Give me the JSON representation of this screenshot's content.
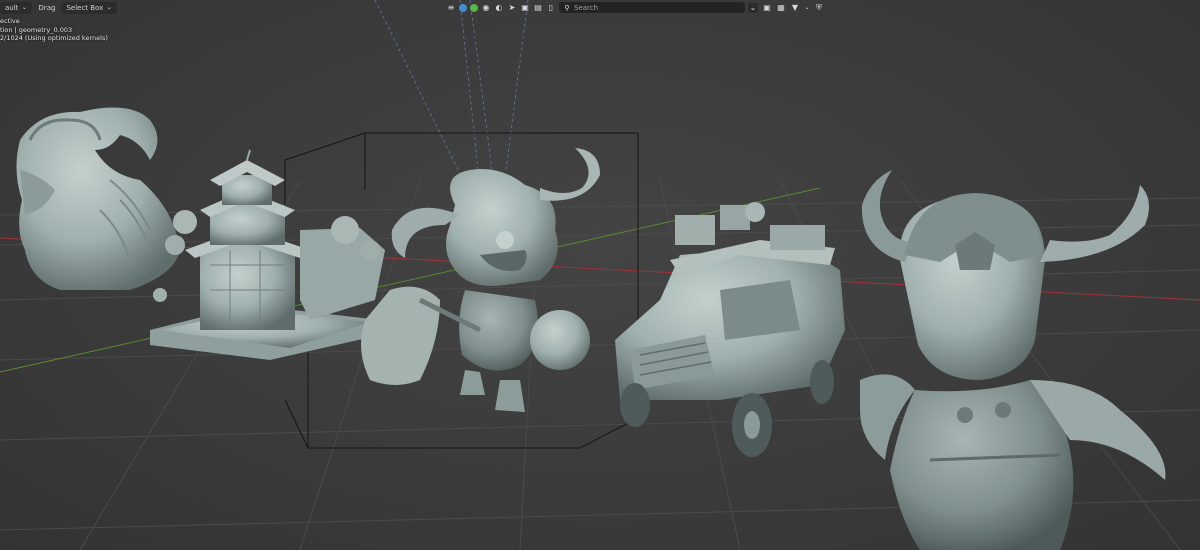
{
  "header": {
    "mode_label": "ault",
    "drag_label": "Drag",
    "select_label": "Select Box",
    "search_placeholder": "Search"
  },
  "overlay": {
    "line1": "ective",
    "line2": "tion | geometry_0.003",
    "line3": "2/1024 (Using optimized kernels)"
  },
  "icons": [
    "chevron-down-icon",
    "view-icon",
    "globe-icon",
    "camera-icon",
    "light-icon",
    "cursor-icon",
    "mesh-icon",
    "image-icon",
    "render-icon",
    "search-icon",
    "camera-view-icon",
    "grid-icon",
    "filter-icon",
    "shield-icon"
  ],
  "colors": {
    "background": "#3a3a3a",
    "model": "#9fb0ae",
    "x_axis": "#a0333a",
    "y_axis": "#5b8a2f",
    "grid": "#4a4a4a"
  }
}
